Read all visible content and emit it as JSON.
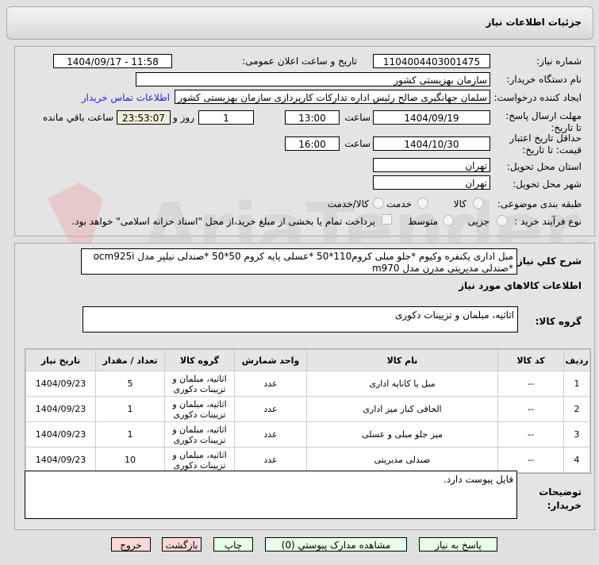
{
  "header": {
    "title": "جزئیات اطلاعات نیاز"
  },
  "form": {
    "need_number_label": "شماره نیاز:",
    "need_number": "1104004403001475",
    "announce_label": "تاریخ و ساعت اعلان عمومی:",
    "announce_value": "1404/09/17 - 11:58",
    "buyer_org_label": "نام دستگاه خریدار:",
    "buyer_org": "سازمان بهزیستی کشور",
    "creator_label": "ایجاد کننده درخواست:",
    "creator": "سلمان جهانگیری صالح رئیس اداره تدارکات کارپردازی سازمان بهزیستی کشور",
    "contact_link": "اطلاعات تماس خریدار",
    "deadline_label": "مهلت ارسال پاسخ: تا تاریخ:",
    "deadline_date": "1404/09/19",
    "time_label": "ساعت",
    "deadline_time": "13:00",
    "days": "1",
    "days_label": "روز و",
    "remaining": "23:53:07",
    "remaining_label": "ساعت باقي مانده",
    "validity_label": "حداقل تاریخ اعتبار قیمت: تا تاریخ:",
    "validity_date": "1404/10/30",
    "validity_time": "16:00",
    "province_label": "استان محل تحویل:",
    "province": "تهران",
    "city_label": "شهر محل تحویل:",
    "city": "تهران",
    "category_label": "طبقه بندی موضوعی:",
    "category_options": [
      "کالا",
      "خدمت",
      "کالا/خدمت"
    ],
    "process_label": "نوع فرآیند خرید :",
    "process_options": [
      "جزیی",
      "متوسط"
    ],
    "payment_note": "پرداخت تمام یا بخشی از مبلغ خرید،از محل \"اسناد خزانه اسلامی\" خواهد بود."
  },
  "details": {
    "summary_label": "شرح کلي نیاز:",
    "summary": "مبل اداری یکنفره وکیوم *جلو مبلی کروم110*50  *عسلی پایه کروم 50*50 *صندلی نیلپر مدل ocm925i *صندلی مدیریتی مدرن مدل m970",
    "goods_info_title": "اطلاعات کالاهاي مورد نیاز",
    "goods_group_label": "گروه کالا:",
    "goods_group": "اثاثیه، مبلمان و تزیینات دکوری",
    "table": {
      "headers": [
        "ردیف",
        "کد کالا",
        "نام کالا",
        "واحد شمارش",
        "گروه کالا",
        "تعداد / مقدار",
        "تاریخ نیاز"
      ],
      "rows": [
        [
          "1",
          "--",
          "مبل یا کاناپه اداری",
          "عدد",
          "اثاثیه، مبلمان و تزیینات دکوری",
          "5",
          "1404/09/23"
        ],
        [
          "2",
          "--",
          "الحاقی کنار میز اداری",
          "عدد",
          "اثاثیه، مبلمان و تزیینات دکوری",
          "1",
          "1404/09/23"
        ],
        [
          "3",
          "--",
          "میز جلو مبلی و عسلی",
          "عدد",
          "اثاثیه، مبلمان و تزیینات دکوری",
          "1",
          "1404/09/23"
        ],
        [
          "4",
          "--",
          "صندلی مدیریتی",
          "عدد",
          "اثاثیه، مبلمان و تزیینات دکوری",
          "10",
          "1404/09/23"
        ]
      ]
    },
    "notes_label": "توضیحات خریدار:",
    "notes": "فایل پیوست دارد."
  },
  "buttons": {
    "reply": "پاسخ به نیاز",
    "attachments": "مشاهده مدارک پیوستي (0)",
    "print": "چاپ",
    "back": "بازگشت",
    "exit": "خروج"
  }
}
